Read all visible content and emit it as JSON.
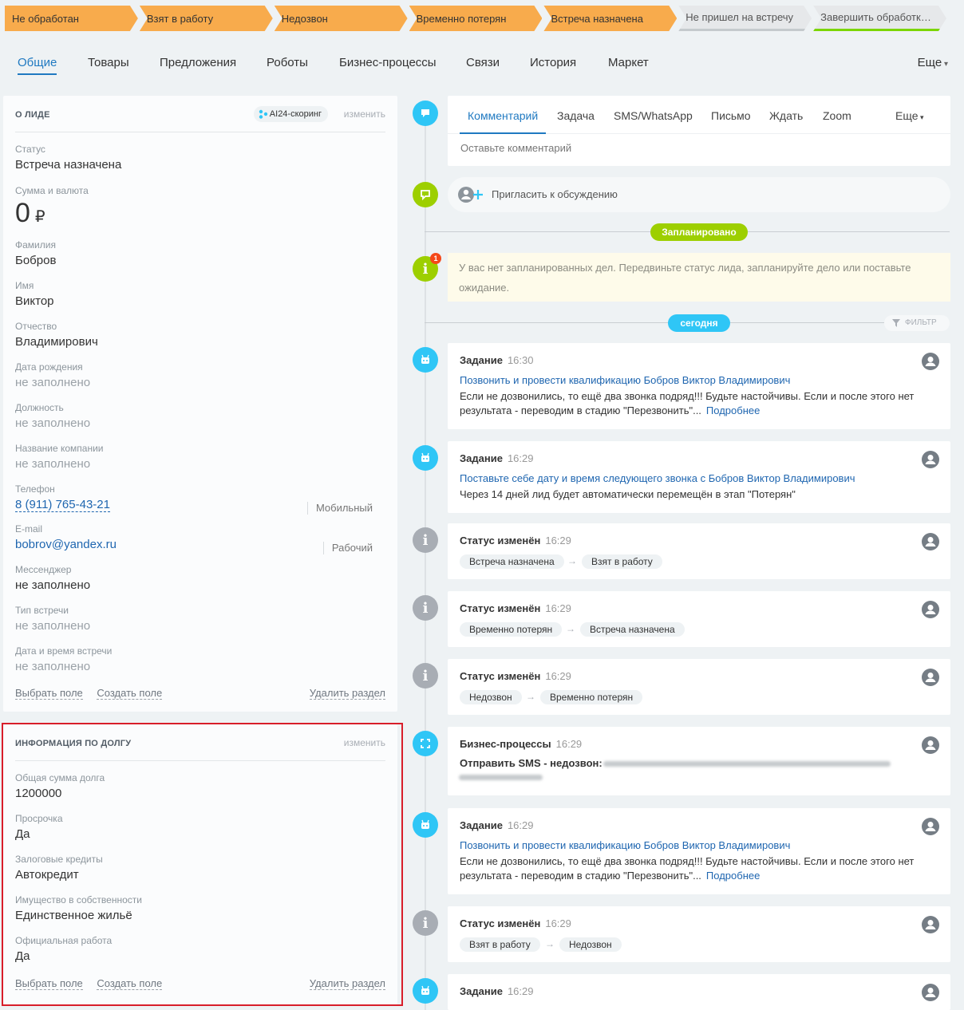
{
  "stages": [
    {
      "label": "Не обработан",
      "style": "done"
    },
    {
      "label": "Взят в работу",
      "style": "done"
    },
    {
      "label": "Недозвон",
      "style": "done"
    },
    {
      "label": "Временно потерян",
      "style": "done"
    },
    {
      "label": "Встреча назначена",
      "style": "done"
    },
    {
      "label": "Не пришел на встречу",
      "style": "grey"
    },
    {
      "label": "Завершить обработку ...",
      "style": "final"
    }
  ],
  "colors": {
    "stage_done": "#f8ab4c",
    "accent_blue": "#1f79c1",
    "timeline_blue": "#2fc6f6",
    "timeline_green": "#9dcf00",
    "highlight_red": "#d81e2a"
  },
  "main_tabs": {
    "general": "Общие",
    "products": "Товары",
    "offers": "Предложения",
    "robots": "Роботы",
    "bizproc": "Бизнес-процессы",
    "links": "Связи",
    "history": "История",
    "market": "Маркет",
    "more": "Еще"
  },
  "lead_panel": {
    "title": "О ЛИДЕ",
    "ai_badge": "AI24-скоринг",
    "change": "изменить",
    "status_label": "Статус",
    "status_value": "Встреча назначена",
    "sum_label": "Сумма и валюта",
    "sum_value": "0",
    "sum_currency": "₽",
    "lastname_label": "Фамилия",
    "lastname_value": "Бобров",
    "name_label": "Имя",
    "name_value": "Виктор",
    "patronymic_label": "Отчество",
    "patronymic_value": "Владимирович",
    "birth_label": "Дата рождения",
    "birth_value": "не заполнено",
    "position_label": "Должность",
    "position_value": "не заполнено",
    "company_label": "Название компании",
    "company_value": "не заполнено",
    "phone_label": "Телефон",
    "phone_value": "8 (911) 765-43-21",
    "phone_type": "Мобильный",
    "email_label": "E-mail",
    "email_value": "bobrov@yandex.ru",
    "email_type": "Рабочий",
    "messenger_label": "Мессенджер",
    "messenger_value": "не заполнено",
    "meeting_type_label": "Тип встречи",
    "meeting_type_value": "не заполнено",
    "meeting_date_label": "Дата и время встречи",
    "meeting_date_value": "не заполнено",
    "select_field": "Выбрать поле",
    "create_field": "Создать поле",
    "delete_section": "Удалить раздел"
  },
  "debt_panel": {
    "title": "ИНФОРМАЦИЯ ПО ДОЛГУ",
    "change": "изменить",
    "total_label": "Общая сумма долга",
    "total_value": "1200000",
    "overdue_label": "Просрочка",
    "overdue_value": "Да",
    "collateral_label": "Залоговые кредиты",
    "collateral_value": "Автокредит",
    "property_label": "Имущество в собственности",
    "property_value": "Единственное жильё",
    "job_label": "Официальная работа",
    "job_value": "Да",
    "select_field": "Выбрать поле",
    "create_field": "Создать поле",
    "delete_section": "Удалить раздел"
  },
  "editor": {
    "tabs": {
      "comment": "Комментарий",
      "task": "Задача",
      "sms": "SMS/WhatsApp",
      "letter": "Письмо",
      "wait": "Ждать",
      "zoom": "Zoom",
      "more": "Еще"
    },
    "placeholder": "Оставьте комментарий"
  },
  "invite": "Пригласить к обсуждению",
  "planned_pill": "Запланировано",
  "notice": {
    "text": "У вас нет запланированных дел. Передвиньте статус лида, запланируйте дело или поставьте ожидание.",
    "badge": "1"
  },
  "today_pill": "сегодня",
  "filter": "ФИЛЬТР",
  "feed": {
    "task1": {
      "type": "Задание",
      "time": "16:30",
      "link": "Позвонить и провести квалификацию Бобров Виктор Владимирович",
      "text": "Если не дозвонились, то ещё два звонка подряд!!! Будьте настойчивы. Если и после этого нет результата - переводим в стадию \"Перезвонить\"...",
      "more": "Подробнее"
    },
    "task2": {
      "type": "Задание",
      "time": "16:29",
      "link": "Поставьте себе дату и время следующего звонка с Бобров Виктор Владимирович",
      "text": "Через 14 дней лид будет автоматически перемещён в этап \"Потерян\""
    },
    "status1": {
      "type": "Статус изменён",
      "time": "16:29",
      "from": "Встреча назначена",
      "to": "Взят в работу"
    },
    "status2": {
      "type": "Статус изменён",
      "time": "16:29",
      "from": "Временно потерян",
      "to": "Встреча назначена"
    },
    "status3": {
      "type": "Статус изменён",
      "time": "16:29",
      "from": "Недозвон",
      "to": "Временно потерян"
    },
    "bp": {
      "type": "Бизнес-процессы",
      "time": "16:29",
      "text": "Отправить SMS - недозвон:"
    },
    "task3": {
      "type": "Задание",
      "time": "16:29",
      "link": "Позвонить и провести квалификацию Бобров Виктор Владимирович",
      "text": "Если не дозвонились, то ещё два звонка подряд!!! Будьте настойчивы. Если и после этого нет результата - переводим в стадию \"Перезвонить\"...",
      "more": "Подробнее"
    },
    "status4": {
      "type": "Статус изменён",
      "time": "16:29",
      "from": "Взят в работу",
      "to": "Недозвон"
    },
    "task4": {
      "type": "Задание",
      "time": "16:29"
    }
  },
  "arrow": "→"
}
